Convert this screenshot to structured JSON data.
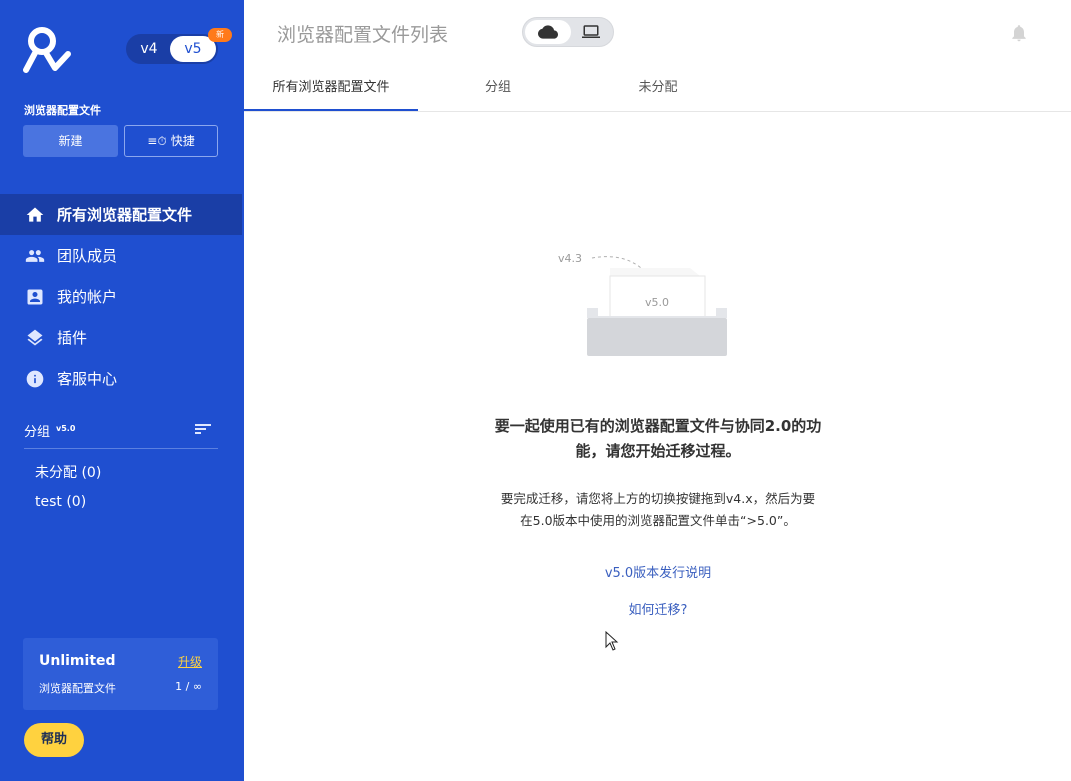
{
  "sidebar": {
    "logo": "brand-logo",
    "version_toggle": {
      "v4": "v4",
      "v5": "v5",
      "selected": "v5",
      "new_badge": "新"
    },
    "profiles_title": "浏览器配置文件",
    "new_button": "新建",
    "quick_button": "快捷",
    "nav": [
      {
        "label": "所有浏览器配置文件",
        "icon": "home-icon",
        "active": true
      },
      {
        "label": "团队成员",
        "icon": "people-icon",
        "active": false
      },
      {
        "label": "我的帐户",
        "icon": "account-box-icon",
        "active": false
      },
      {
        "label": "插件",
        "icon": "layers-icon",
        "active": false
      },
      {
        "label": "客服中心",
        "icon": "info-icon",
        "active": false
      }
    ],
    "groups": {
      "label": "分组",
      "version": "v5.0",
      "items": [
        {
          "label": "未分配 (0)"
        },
        {
          "label": "test  (0)"
        }
      ]
    },
    "plan": {
      "name": "Unlimited",
      "upgrade": "升级",
      "profiles_label": "浏览器配置文件",
      "profiles_count": "1 / ∞"
    },
    "help_button": "帮助"
  },
  "header": {
    "title": "浏览器配置文件列表",
    "storage_toggle": {
      "selected": "cloud"
    }
  },
  "tabs": [
    {
      "label": "所有浏览器配置文件",
      "active": true
    },
    {
      "label": "分组",
      "active": false
    },
    {
      "label": "未分配",
      "active": false
    }
  ],
  "empty_state": {
    "illustration_from": "v4.3",
    "illustration_to": "v5.0",
    "message_line1": "要一起使用已有的浏览器配置文件与协同2.0的功",
    "message_line2": "能，请您开始迁移过程。",
    "sub_line1": "要完成迁移，请您将上方的切换按键拖到v4.x，然后为要",
    "sub_line2": "在5.0版本中使用的浏览器配置文件单击“>5.0”。",
    "link_release": "v5.0版本发行说明",
    "link_migrate": "如何迁移?"
  },
  "colors": {
    "sidebar_bg": "#1f4fd0",
    "sidebar_active": "#1a3ea6",
    "accent_yellow": "#ffd23f",
    "link": "#3a5fbf"
  }
}
